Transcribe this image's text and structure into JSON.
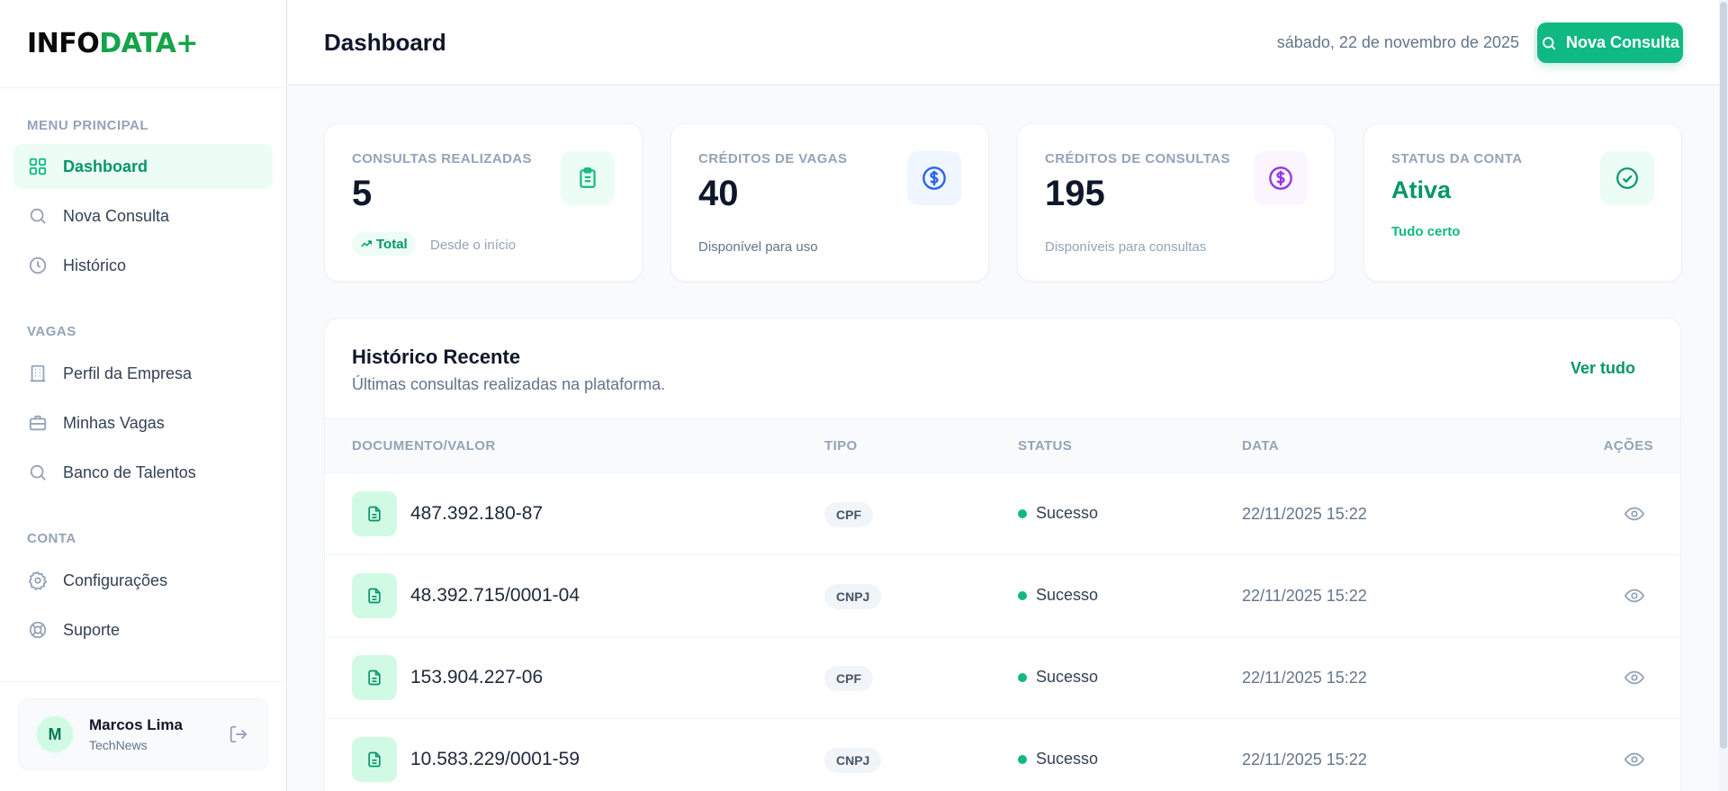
{
  "brand": {
    "logo_prefix": "INFO",
    "logo_suffix": "DATA+"
  },
  "sidebar": {
    "sections": [
      {
        "heading": "MENU PRINCIPAL",
        "items": [
          {
            "label": "Dashboard",
            "icon": "grid-icon",
            "active": true
          },
          {
            "label": "Nova Consulta",
            "icon": "search-icon"
          },
          {
            "label": "Histórico",
            "icon": "clock-icon"
          }
        ]
      },
      {
        "heading": "VAGAS",
        "items": [
          {
            "label": "Perfil da Empresa",
            "icon": "building-icon"
          },
          {
            "label": "Minhas Vagas",
            "icon": "briefcase-icon"
          },
          {
            "label": "Banco de Talentos",
            "icon": "search-icon"
          }
        ]
      },
      {
        "heading": "CONTA",
        "items": [
          {
            "label": "Configurações",
            "icon": "gear-icon"
          },
          {
            "label": "Suporte",
            "icon": "lifebuoy-icon"
          }
        ]
      }
    ],
    "user": {
      "initial": "M",
      "name": "Marcos Lima",
      "company": "TechNews"
    }
  },
  "header": {
    "title": "Dashboard",
    "date": "sábado, 22 de novembro de 2025",
    "new_query_label": "Nova Consulta"
  },
  "stats": [
    {
      "label": "CONSULTAS REALIZADAS",
      "value": "5",
      "pill": "Total",
      "sub": "Desde o início",
      "icon": "clipboard-icon",
      "accent": "#10b981",
      "icon_bg": "#ecfdf5"
    },
    {
      "label": "CRÉDITOS DE VAGAS",
      "value": "40",
      "sub": "Disponível para uso",
      "icon": "dollar-circle-icon",
      "accent": "#2563eb",
      "icon_bg": "#eff6ff"
    },
    {
      "label": "CRÉDITOS DE CONSULTAS",
      "value": "195",
      "sub": "Disponíveis para consultas",
      "icon": "dollar-circle-icon",
      "accent": "#9333ea",
      "icon_bg": "#faf5ff"
    },
    {
      "label": "STATUS DA CONTA",
      "value": "Ativa",
      "sub": "Tudo certo",
      "icon": "check-circle-icon",
      "accent": "#059669",
      "icon_bg": "#ecfdf5"
    }
  ],
  "history": {
    "title": "Histórico Recente",
    "subtitle": "Últimas consultas realizadas na plataforma.",
    "view_all": "Ver tudo",
    "columns": [
      "DOCUMENTO/VALOR",
      "TIPO",
      "STATUS",
      "DATA",
      "AÇÕES"
    ],
    "rows": [
      {
        "document": "487.392.180-87",
        "type": "CPF",
        "status": "Sucesso",
        "date": "22/11/2025 15:22"
      },
      {
        "document": "48.392.715/0001-04",
        "type": "CNPJ",
        "status": "Sucesso",
        "date": "22/11/2025 15:22"
      },
      {
        "document": "153.904.227-06",
        "type": "CPF",
        "status": "Sucesso",
        "date": "22/11/2025 15:22"
      },
      {
        "document": "10.583.229/0001-59",
        "type": "CNPJ",
        "status": "Sucesso",
        "date": "22/11/2025 15:22"
      }
    ]
  },
  "colors": {
    "primary": "#10b981",
    "primary_dark": "#059669",
    "success_dot": "#10b981"
  }
}
